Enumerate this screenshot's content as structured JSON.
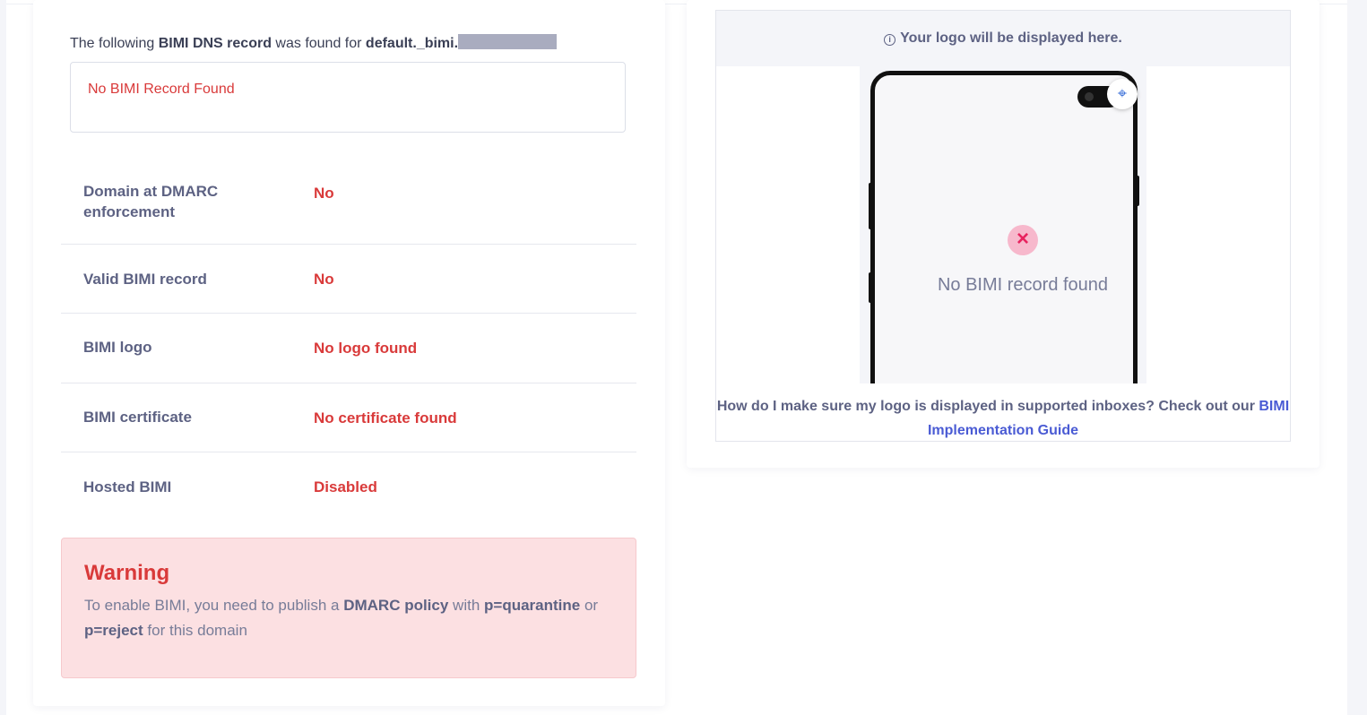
{
  "record": {
    "prefix": "The following ",
    "strong": "BIMI DNS record",
    "middle": " was found for ",
    "domain": "default._bimi.",
    "result": "No BIMI Record Found"
  },
  "checks": [
    {
      "label": "Domain at DMARC enforcement",
      "value": "No"
    },
    {
      "label": "Valid BIMI record",
      "value": "No"
    },
    {
      "label": "BIMI logo",
      "value": "No logo found"
    },
    {
      "label": "BIMI certificate",
      "value": "No certificate found"
    },
    {
      "label": "Hosted BIMI",
      "value": "Disabled"
    }
  ],
  "warning": {
    "title": "Warning",
    "t1": "To enable BIMI, you need to publish a ",
    "b1": "DMARC policy",
    "t2": " with ",
    "b2": "p=quarantine",
    "t3": " or ",
    "b3": "p=reject",
    "t4": " for this domain"
  },
  "preview": {
    "title": "Your logo will be displayed here.",
    "no_record": "No BIMI record found",
    "help": "How do I make sure my logo is displayed in supported inboxes? Check out our ",
    "link": "BIMI Implementation Guide"
  },
  "colors": {
    "error": "#d93a3a",
    "label": "#5d6283",
    "link": "#4a5bd4",
    "warning_bg": "#fce0e2"
  },
  "icons": [
    "info-icon",
    "close-icon",
    "focus-scan-icon"
  ]
}
